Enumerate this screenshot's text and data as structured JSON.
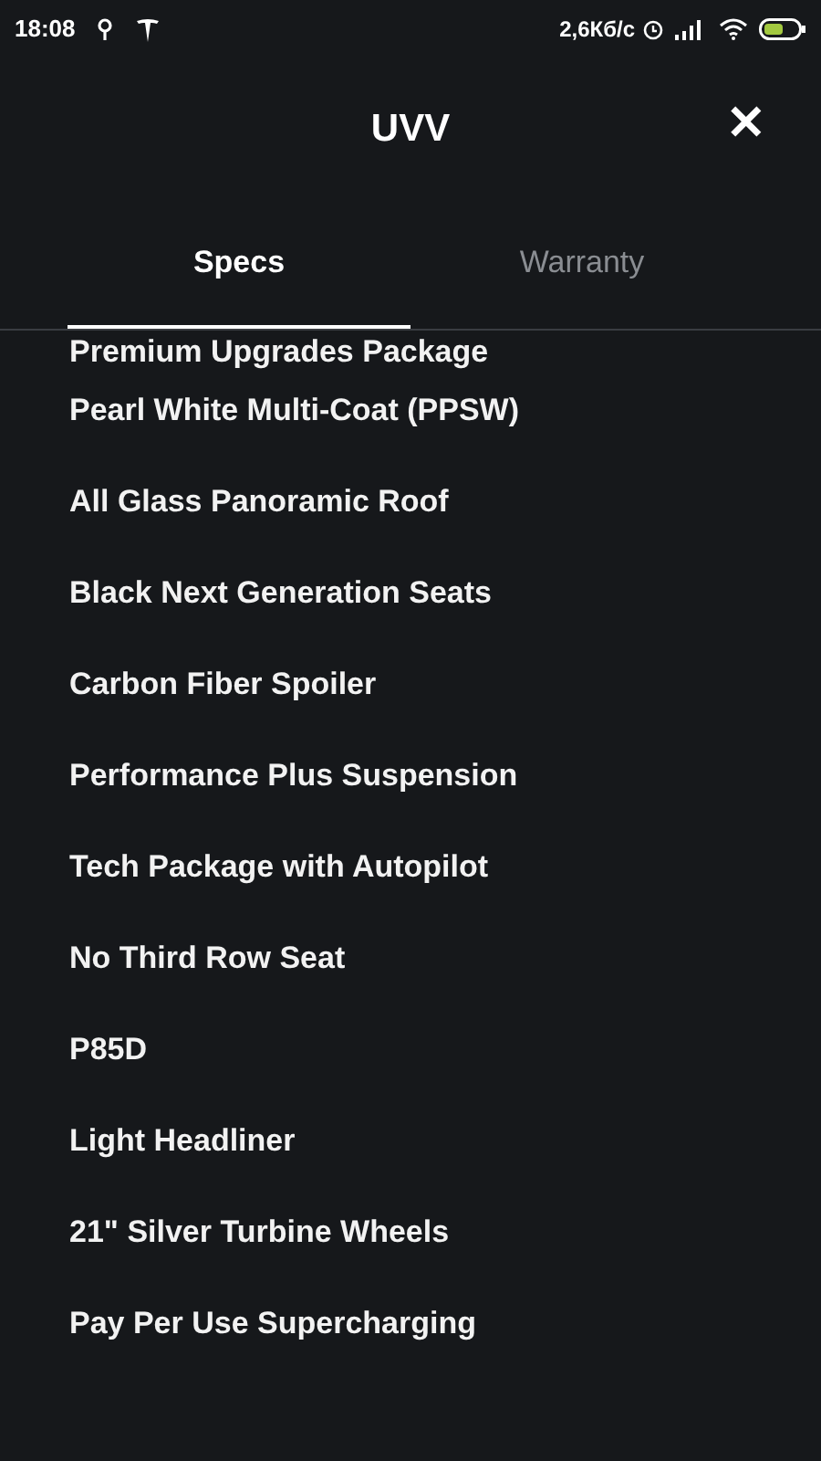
{
  "status_bar": {
    "time": "18:08",
    "speed": "2,6Кб/с"
  },
  "header": {
    "title": "UVV",
    "close": "✕"
  },
  "tabs": [
    {
      "label": "Specs",
      "selected": true
    },
    {
      "label": "Warranty",
      "selected": false
    }
  ],
  "options": [
    "Premium Upgrades Package",
    "Pearl White Multi-Coat (PPSW)",
    "All Glass Panoramic Roof",
    "Black Next Generation Seats",
    "Carbon Fiber Spoiler",
    "Performance Plus Suspension",
    "Tech Package with Autopilot",
    "No Third Row Seat",
    "P85D",
    "Light Headliner",
    "21\" Silver Turbine Wheels",
    "Pay Per Use Supercharging"
  ]
}
